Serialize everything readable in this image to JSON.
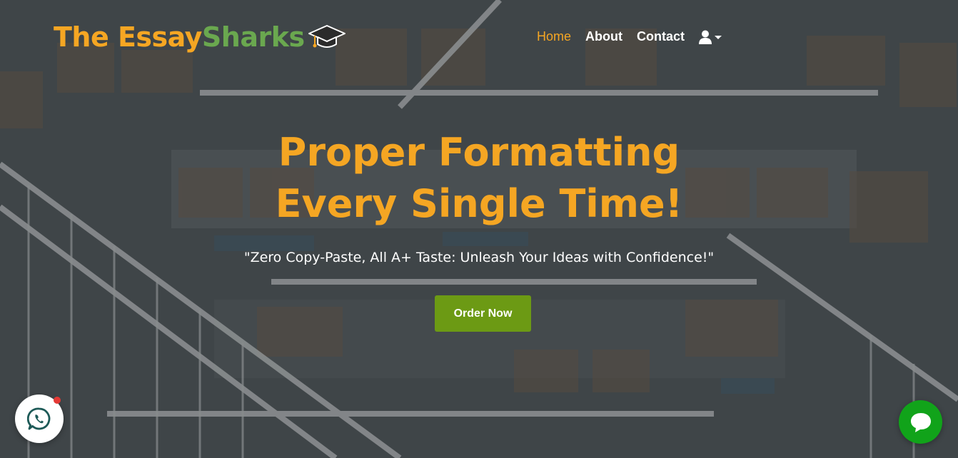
{
  "brand": {
    "part1": "The Essay",
    "part2": "Sharks",
    "logo_icon": "graduation-cap-icon",
    "colors": {
      "primary": "#f5a623",
      "secondary": "#6aa84f"
    }
  },
  "nav": {
    "items": [
      {
        "label": "Home",
        "active": true
      },
      {
        "label": "About",
        "active": false
      },
      {
        "label": "Contact",
        "active": false
      }
    ],
    "user_icon": "user-icon",
    "dropdown_icon": "caret-down-icon"
  },
  "hero": {
    "title": "Proper Formatting Every Single Time!",
    "subtitle": "\"Zero Copy-Paste, All A+ Taste: Unleash Your Ideas with Confidence!\"",
    "cta_label": "Order Now",
    "cta_color": "#6c9a14"
  },
  "widgets": {
    "whatsapp_icon": "whatsapp-icon",
    "chat_icon": "chat-bubble-icon",
    "chat_color": "#11a31a"
  }
}
